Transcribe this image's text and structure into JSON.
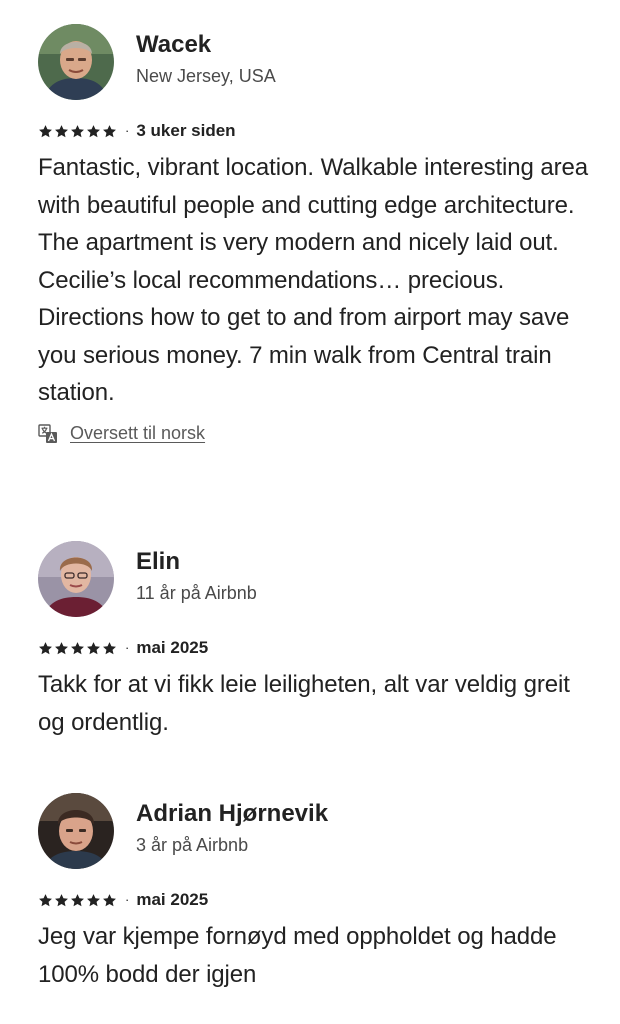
{
  "reviews": [
    {
      "name": "Wacek",
      "meta": "New Jersey, USA",
      "rating": 5,
      "separator": "·",
      "date": "3 uker siden",
      "text": "Fantastic, vibrant location. Walkable interesting area with beautiful people and cutting edge architecture. The apartment is very modern and nicely laid out. Cecilie’s local recommendations… precious. Directions how to get to and from airport may save you serious money. 7 min walk from Central train station.",
      "translate_label": "Oversett til norsk"
    },
    {
      "name": "Elin",
      "meta": "11 år på Airbnb",
      "rating": 5,
      "separator": "·",
      "date": "mai 2025",
      "text": "Takk for at vi fikk leie leiligheten, alt var veldig greit og ordentlig."
    },
    {
      "name": "Adrian Hjørnevik",
      "meta": "3 år på Airbnb",
      "rating": 5,
      "separator": "·",
      "date": "mai 2025",
      "text": "Jeg var kjempe fornøyd med oppholdet og hadde 100% bodd der igjen"
    }
  ],
  "colors": {
    "text": "#222222",
    "secondary": "#4a4a4a",
    "star": "#222222"
  },
  "icons": {
    "star": "star-icon",
    "translate": "translate-icon"
  }
}
